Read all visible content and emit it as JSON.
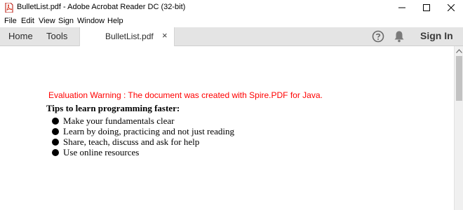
{
  "window": {
    "title": "BulletList.pdf - Adobe Acrobat Reader DC (32-bit)",
    "icon": "acrobat-pdf-icon"
  },
  "menu": [
    "File",
    "Edit",
    "View",
    "Sign",
    "Window",
    "Help"
  ],
  "toolbar": {
    "home_label": "Home",
    "tools_label": "Tools",
    "doc_tab_label": "BulletList.pdf",
    "close_glyph": "×",
    "sign_in_label": "Sign In"
  },
  "document": {
    "warning": "Evaluation Warning : The document was created with Spire.PDF for Java.",
    "warning_color": "#ff0000",
    "heading": "Tips to learn programming faster:",
    "bullets": [
      "Make your fundamentals clear",
      "Learn by doing, practicing and not just reading",
      "Share, teach, discuss and ask for help",
      "Use online resources"
    ]
  }
}
